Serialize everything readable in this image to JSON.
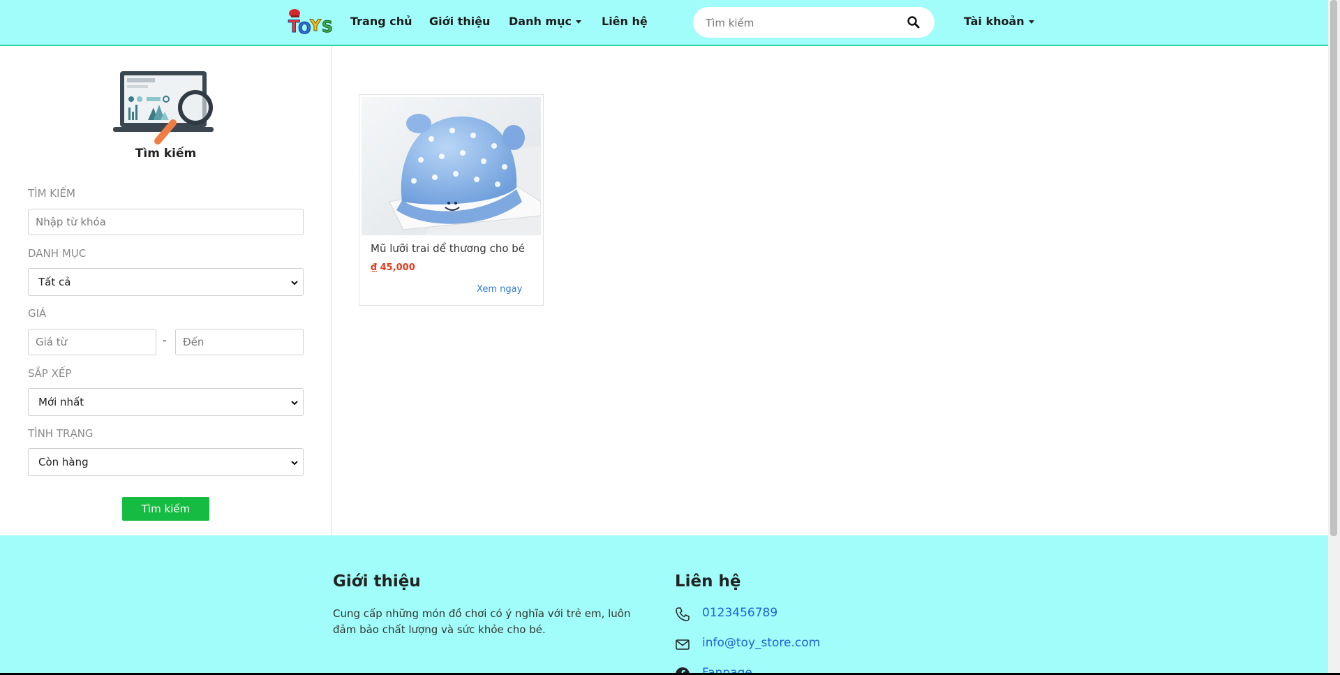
{
  "nav": {
    "logo_text": "TOYS",
    "items": [
      {
        "label": "Trang chủ"
      },
      {
        "label": "Giới thiệu"
      },
      {
        "label": "Danh mục"
      },
      {
        "label": "Liên hệ"
      }
    ],
    "search_placeholder": "Tìm kiếm",
    "account_label": "Tài khoản"
  },
  "sidebar": {
    "title": "Tìm kiếm",
    "keyword_label": "TÌM KIẾM",
    "keyword_placeholder": "Nhập từ khóa",
    "category_label": "DANH MỤC",
    "category_value": "Tất cả",
    "price_label": "GIÁ",
    "price_from_placeholder": "Giá từ",
    "price_separator": "-",
    "price_to_placeholder": "Đến",
    "sort_label": "SẮP XẾP",
    "sort_value": "Mới nhất",
    "status_label": "TÌNH TRẠNG",
    "status_value": "Còn hàng",
    "submit_label": "Tìm kiếm"
  },
  "products": [
    {
      "name": "Mũ lưỡi trai dể thương cho bé",
      "currency": "₫",
      "price": "45,000",
      "link_label": "Xem ngay"
    }
  ],
  "footer": {
    "about_title": "Giới thiệu",
    "about_text": "Cung cấp những món đồ chơi có ý nghĩa với trẻ em, luôn đảm bảo chất lượng và sức khỏe cho bé.",
    "contact_title": "Liên hệ",
    "phone": "0123456789",
    "email": "info@toy_store.com",
    "fanpage": "Fanpage"
  },
  "colors": {
    "header_bg": "#a0fdf9",
    "accent_green": "#16bb42",
    "price_red": "#e53d1e",
    "link_blue": "#2f7bd9"
  }
}
